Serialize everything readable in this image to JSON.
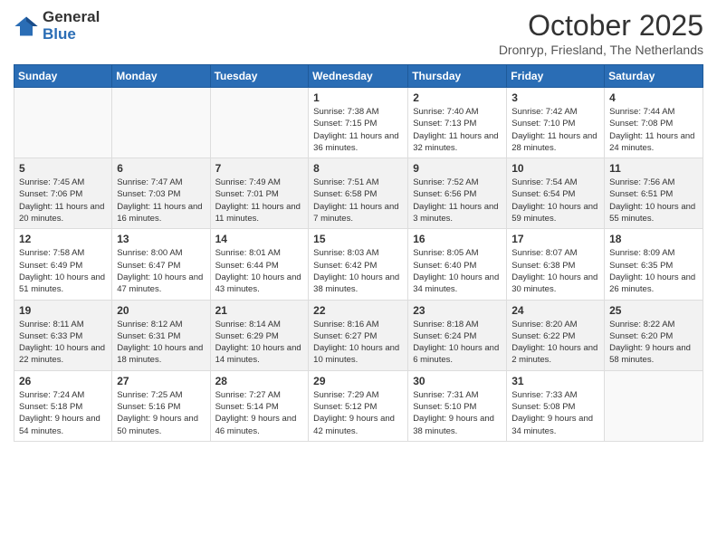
{
  "header": {
    "logo_general": "General",
    "logo_blue": "Blue",
    "month_title": "October 2025",
    "location": "Dronryp, Friesland, The Netherlands"
  },
  "weekdays": [
    "Sunday",
    "Monday",
    "Tuesday",
    "Wednesday",
    "Thursday",
    "Friday",
    "Saturday"
  ],
  "weeks": [
    [
      {
        "day": "",
        "sunrise": "",
        "sunset": "",
        "daylight": ""
      },
      {
        "day": "",
        "sunrise": "",
        "sunset": "",
        "daylight": ""
      },
      {
        "day": "",
        "sunrise": "",
        "sunset": "",
        "daylight": ""
      },
      {
        "day": "1",
        "sunrise": "Sunrise: 7:38 AM",
        "sunset": "Sunset: 7:15 PM",
        "daylight": "Daylight: 11 hours and 36 minutes."
      },
      {
        "day": "2",
        "sunrise": "Sunrise: 7:40 AM",
        "sunset": "Sunset: 7:13 PM",
        "daylight": "Daylight: 11 hours and 32 minutes."
      },
      {
        "day": "3",
        "sunrise": "Sunrise: 7:42 AM",
        "sunset": "Sunset: 7:10 PM",
        "daylight": "Daylight: 11 hours and 28 minutes."
      },
      {
        "day": "4",
        "sunrise": "Sunrise: 7:44 AM",
        "sunset": "Sunset: 7:08 PM",
        "daylight": "Daylight: 11 hours and 24 minutes."
      }
    ],
    [
      {
        "day": "5",
        "sunrise": "Sunrise: 7:45 AM",
        "sunset": "Sunset: 7:06 PM",
        "daylight": "Daylight: 11 hours and 20 minutes."
      },
      {
        "day": "6",
        "sunrise": "Sunrise: 7:47 AM",
        "sunset": "Sunset: 7:03 PM",
        "daylight": "Daylight: 11 hours and 16 minutes."
      },
      {
        "day": "7",
        "sunrise": "Sunrise: 7:49 AM",
        "sunset": "Sunset: 7:01 PM",
        "daylight": "Daylight: 11 hours and 11 minutes."
      },
      {
        "day": "8",
        "sunrise": "Sunrise: 7:51 AM",
        "sunset": "Sunset: 6:58 PM",
        "daylight": "Daylight: 11 hours and 7 minutes."
      },
      {
        "day": "9",
        "sunrise": "Sunrise: 7:52 AM",
        "sunset": "Sunset: 6:56 PM",
        "daylight": "Daylight: 11 hours and 3 minutes."
      },
      {
        "day": "10",
        "sunrise": "Sunrise: 7:54 AM",
        "sunset": "Sunset: 6:54 PM",
        "daylight": "Daylight: 10 hours and 59 minutes."
      },
      {
        "day": "11",
        "sunrise": "Sunrise: 7:56 AM",
        "sunset": "Sunset: 6:51 PM",
        "daylight": "Daylight: 10 hours and 55 minutes."
      }
    ],
    [
      {
        "day": "12",
        "sunrise": "Sunrise: 7:58 AM",
        "sunset": "Sunset: 6:49 PM",
        "daylight": "Daylight: 10 hours and 51 minutes."
      },
      {
        "day": "13",
        "sunrise": "Sunrise: 8:00 AM",
        "sunset": "Sunset: 6:47 PM",
        "daylight": "Daylight: 10 hours and 47 minutes."
      },
      {
        "day": "14",
        "sunrise": "Sunrise: 8:01 AM",
        "sunset": "Sunset: 6:44 PM",
        "daylight": "Daylight: 10 hours and 43 minutes."
      },
      {
        "day": "15",
        "sunrise": "Sunrise: 8:03 AM",
        "sunset": "Sunset: 6:42 PM",
        "daylight": "Daylight: 10 hours and 38 minutes."
      },
      {
        "day": "16",
        "sunrise": "Sunrise: 8:05 AM",
        "sunset": "Sunset: 6:40 PM",
        "daylight": "Daylight: 10 hours and 34 minutes."
      },
      {
        "day": "17",
        "sunrise": "Sunrise: 8:07 AM",
        "sunset": "Sunset: 6:38 PM",
        "daylight": "Daylight: 10 hours and 30 minutes."
      },
      {
        "day": "18",
        "sunrise": "Sunrise: 8:09 AM",
        "sunset": "Sunset: 6:35 PM",
        "daylight": "Daylight: 10 hours and 26 minutes."
      }
    ],
    [
      {
        "day": "19",
        "sunrise": "Sunrise: 8:11 AM",
        "sunset": "Sunset: 6:33 PM",
        "daylight": "Daylight: 10 hours and 22 minutes."
      },
      {
        "day": "20",
        "sunrise": "Sunrise: 8:12 AM",
        "sunset": "Sunset: 6:31 PM",
        "daylight": "Daylight: 10 hours and 18 minutes."
      },
      {
        "day": "21",
        "sunrise": "Sunrise: 8:14 AM",
        "sunset": "Sunset: 6:29 PM",
        "daylight": "Daylight: 10 hours and 14 minutes."
      },
      {
        "day": "22",
        "sunrise": "Sunrise: 8:16 AM",
        "sunset": "Sunset: 6:27 PM",
        "daylight": "Daylight: 10 hours and 10 minutes."
      },
      {
        "day": "23",
        "sunrise": "Sunrise: 8:18 AM",
        "sunset": "Sunset: 6:24 PM",
        "daylight": "Daylight: 10 hours and 6 minutes."
      },
      {
        "day": "24",
        "sunrise": "Sunrise: 8:20 AM",
        "sunset": "Sunset: 6:22 PM",
        "daylight": "Daylight: 10 hours and 2 minutes."
      },
      {
        "day": "25",
        "sunrise": "Sunrise: 8:22 AM",
        "sunset": "Sunset: 6:20 PM",
        "daylight": "Daylight: 9 hours and 58 minutes."
      }
    ],
    [
      {
        "day": "26",
        "sunrise": "Sunrise: 7:24 AM",
        "sunset": "Sunset: 5:18 PM",
        "daylight": "Daylight: 9 hours and 54 minutes."
      },
      {
        "day": "27",
        "sunrise": "Sunrise: 7:25 AM",
        "sunset": "Sunset: 5:16 PM",
        "daylight": "Daylight: 9 hours and 50 minutes."
      },
      {
        "day": "28",
        "sunrise": "Sunrise: 7:27 AM",
        "sunset": "Sunset: 5:14 PM",
        "daylight": "Daylight: 9 hours and 46 minutes."
      },
      {
        "day": "29",
        "sunrise": "Sunrise: 7:29 AM",
        "sunset": "Sunset: 5:12 PM",
        "daylight": "Daylight: 9 hours and 42 minutes."
      },
      {
        "day": "30",
        "sunrise": "Sunrise: 7:31 AM",
        "sunset": "Sunset: 5:10 PM",
        "daylight": "Daylight: 9 hours and 38 minutes."
      },
      {
        "day": "31",
        "sunrise": "Sunrise: 7:33 AM",
        "sunset": "Sunset: 5:08 PM",
        "daylight": "Daylight: 9 hours and 34 minutes."
      },
      {
        "day": "",
        "sunrise": "",
        "sunset": "",
        "daylight": ""
      }
    ]
  ]
}
